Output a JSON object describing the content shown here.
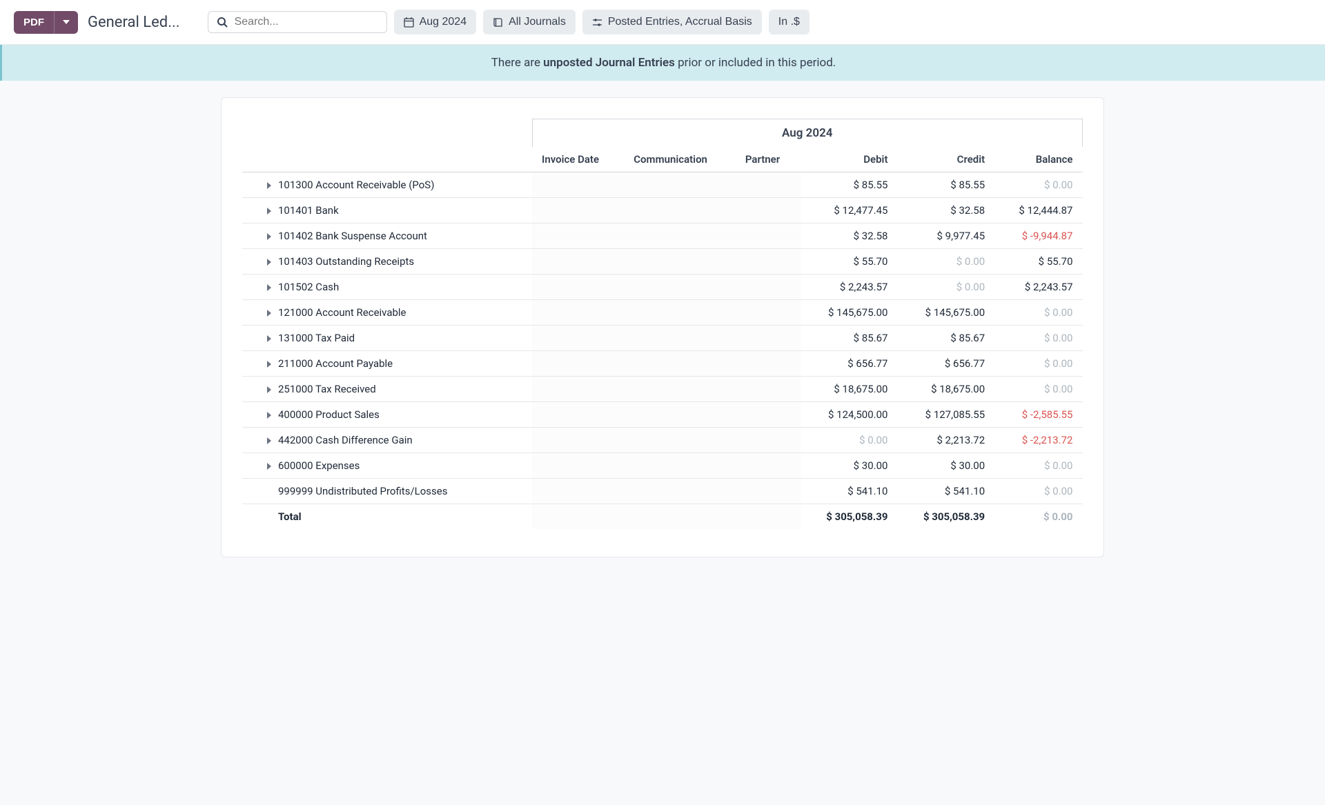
{
  "toolbar": {
    "pdf_label": "PDF",
    "title": "General Led...",
    "search_placeholder": "Search...",
    "date_filter": "Aug 2024",
    "journals_filter": "All Journals",
    "entries_filter": "Posted Entries, Accrual Basis",
    "currency_filter": "In .$"
  },
  "banner": {
    "prefix": "There are ",
    "strong": "unposted Journal Entries",
    "suffix": " prior or included in this period."
  },
  "table": {
    "period_label": "Aug 2024",
    "columns": {
      "invoice_date": "Invoice Date",
      "communication": "Communication",
      "partner": "Partner",
      "debit": "Debit",
      "credit": "Credit",
      "balance": "Balance"
    },
    "rows": [
      {
        "name": "101300 Account Receivable (PoS)",
        "debit": "$ 85.55",
        "credit": "$ 85.55",
        "balance": "$ 0.00",
        "balance_zero": true,
        "expandable": true
      },
      {
        "name": "101401 Bank",
        "debit": "$ 12,477.45",
        "credit": "$ 32.58",
        "balance": "$ 12,444.87",
        "balance_zero": false,
        "expandable": true
      },
      {
        "name": "101402 Bank Suspense Account",
        "debit": "$ 32.58",
        "credit": "$ 9,977.45",
        "balance": "$ -9,944.87",
        "balance_zero": false,
        "balance_neg": true,
        "expandable": true
      },
      {
        "name": "101403 Outstanding Receipts",
        "debit": "$ 55.70",
        "credit": "$ 0.00",
        "credit_zero": true,
        "balance": "$ 55.70",
        "balance_zero": false,
        "expandable": true
      },
      {
        "name": "101502 Cash",
        "debit": "$ 2,243.57",
        "credit": "$ 0.00",
        "credit_zero": true,
        "balance": "$ 2,243.57",
        "balance_zero": false,
        "expandable": true
      },
      {
        "name": "121000 Account Receivable",
        "debit": "$ 145,675.00",
        "credit": "$ 145,675.00",
        "balance": "$ 0.00",
        "balance_zero": true,
        "expandable": true
      },
      {
        "name": "131000 Tax Paid",
        "debit": "$ 85.67",
        "credit": "$ 85.67",
        "balance": "$ 0.00",
        "balance_zero": true,
        "expandable": true
      },
      {
        "name": "211000 Account Payable",
        "debit": "$ 656.77",
        "credit": "$ 656.77",
        "balance": "$ 0.00",
        "balance_zero": true,
        "expandable": true
      },
      {
        "name": "251000 Tax Received",
        "debit": "$ 18,675.00",
        "credit": "$ 18,675.00",
        "balance": "$ 0.00",
        "balance_zero": true,
        "expandable": true
      },
      {
        "name": "400000 Product Sales",
        "debit": "$ 124,500.00",
        "credit": "$ 127,085.55",
        "balance": "$ -2,585.55",
        "balance_zero": false,
        "balance_neg": true,
        "expandable": true
      },
      {
        "name": "442000 Cash Difference Gain",
        "debit": "$ 0.00",
        "debit_zero": true,
        "credit": "$ 2,213.72",
        "balance": "$ -2,213.72",
        "balance_zero": false,
        "balance_neg": true,
        "expandable": true
      },
      {
        "name": "600000 Expenses",
        "debit": "$ 30.00",
        "credit": "$ 30.00",
        "balance": "$ 0.00",
        "balance_zero": true,
        "expandable": true
      },
      {
        "name": "999999 Undistributed Profits/Losses",
        "debit": "$ 541.10",
        "credit": "$ 541.10",
        "balance": "$ 0.00",
        "balance_zero": true,
        "expandable": false
      }
    ],
    "total": {
      "label": "Total",
      "debit": "$ 305,058.39",
      "credit": "$ 305,058.39",
      "balance": "$ 0.00",
      "balance_zero": true
    }
  }
}
